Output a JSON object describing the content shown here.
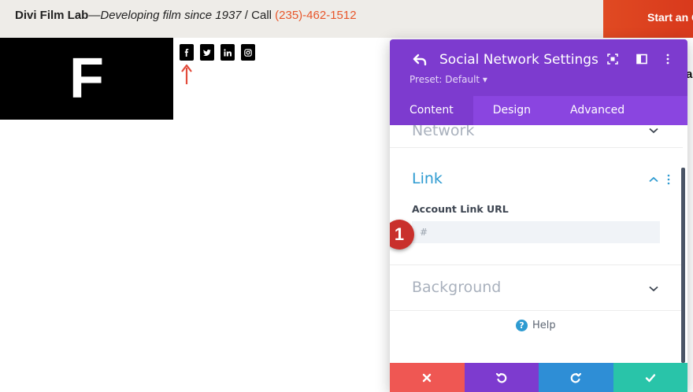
{
  "topbar": {
    "brand": "Divi Film Lab",
    "dash": "—",
    "tagline": "Developing film since 1937",
    "call_text": " / Call ",
    "phone": "(235)-462-1512",
    "cta_label": "Start an C"
  },
  "logo": {
    "letter": "F"
  },
  "social_icons": [
    "facebook-icon",
    "twitter-icon",
    "linkedin-icon",
    "instagram-icon"
  ],
  "side_letter": "a",
  "panel": {
    "title": "Social Network Settings",
    "preset": "Preset: Default ▾",
    "tabs": [
      {
        "label": "Content",
        "active": true
      },
      {
        "label": "Design",
        "active": false
      },
      {
        "label": "Advanced",
        "active": false
      }
    ],
    "sections": {
      "network": "Network",
      "link": "Link",
      "background": "Background"
    },
    "field": {
      "label": "Account Link URL",
      "value": "#"
    },
    "callout_number": "1",
    "help_label": "Help",
    "help_glyph": "?"
  },
  "colors": {
    "panel_purple": "#7d3bcf",
    "tabs_purple": "#8a45e0",
    "link_blue": "#2e9bd1",
    "cancel_red": "#ef5753",
    "undo_purple": "#7d3bcf",
    "redo_blue": "#2e8ed6",
    "save_green": "#29c4a9",
    "phone_orange": "#e8562a",
    "callout_red": "#c9302c"
  }
}
